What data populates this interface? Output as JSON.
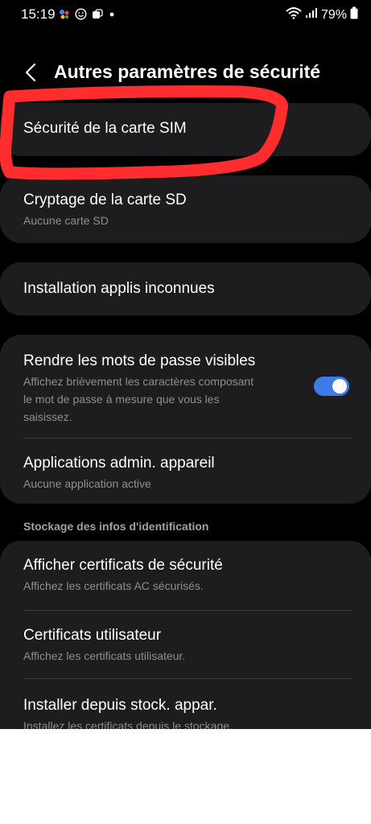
{
  "status_bar": {
    "time": "15:19",
    "battery": "79%",
    "icons_left": [
      "assistant-icon",
      "smiley-icon",
      "gallery-icon",
      "dot-icon"
    ],
    "icons_right": [
      "wifi-icon",
      "signal-icon",
      "battery-icon"
    ]
  },
  "header": {
    "title": "Autres paramètres de sécurité",
    "back_icon": "chevron-left-icon"
  },
  "items": {
    "sim_security": {
      "title": "Sécurité de la carte SIM"
    },
    "sd_encryption": {
      "title": "Cryptage de la carte SD",
      "subtitle": "Aucune carte SD"
    },
    "unknown_apps": {
      "title": "Installation applis inconnues"
    },
    "show_passwords": {
      "title": "Rendre les mots de passe visibles",
      "subtitle_line1": "Affichez brièvement les caractères composant",
      "subtitle_line2": "le mot de passe à mesure que vous les",
      "subtitle_line3": "saisissez.",
      "toggle_on": true
    },
    "device_admin": {
      "title": "Applications admin. appareil",
      "subtitle": "Aucune application active"
    }
  },
  "credentials_section": {
    "label": "Stockage des infos d'identification",
    "items": {
      "view_certs": {
        "title": "Afficher certificats de sécurité",
        "subtitle": "Affichez les certificats AC sécurisés."
      },
      "user_certs": {
        "title": "Certificats utilisateur",
        "subtitle": "Affichez les certificats utilisateur."
      },
      "install_storage": {
        "title": "Installer depuis stock. appar.",
        "subtitle": "Installez les certificats depuis le stockage."
      }
    }
  },
  "colors": {
    "background": "#000000",
    "card": "#1d1d1f",
    "accent": "#3e7bea",
    "annotation": "#ff2d2d"
  }
}
